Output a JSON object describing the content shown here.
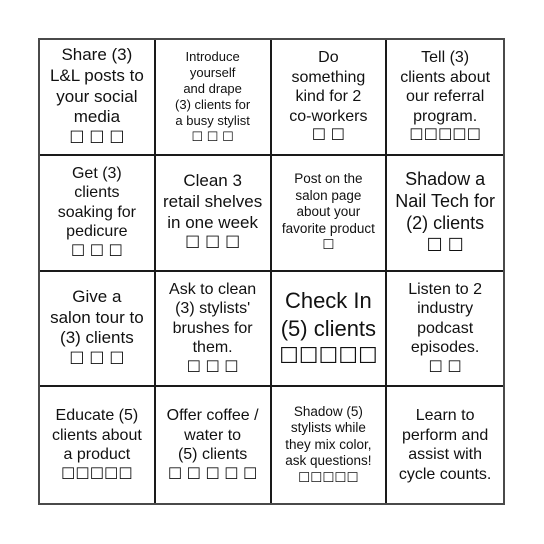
{
  "board": {
    "cells": [
      {
        "text": "Share (3)\nL&L posts to\nyour social\nmedia",
        "boxes": "☐ ☐ ☐"
      },
      {
        "text": "Introduce\nyourself\nand drape\n(3) clients for\na busy stylist",
        "boxes": "☐ ☐ ☐"
      },
      {
        "text": "Do\nsomething\nkind for 2\nco-workers",
        "boxes": "☐ ☐"
      },
      {
        "text": "Tell (3)\nclients about\nour referral\nprogram.",
        "boxes": "☐☐☐☐☐"
      },
      {
        "text": "Get (3)\nclients\nsoaking for\npedicure",
        "boxes": "☐ ☐ ☐"
      },
      {
        "text": "Clean 3\nretail shelves\nin one week",
        "boxes": "☐ ☐ ☐"
      },
      {
        "text": "Post on the\nsalon page\nabout your\nfavorite product",
        "boxes": "☐"
      },
      {
        "text": "Shadow a\nNail Tech for\n(2) clients",
        "boxes": "☐ ☐"
      },
      {
        "text": "Give a\nsalon tour to\n(3) clients",
        "boxes": "☐ ☐ ☐"
      },
      {
        "text": "Ask to clean\n(3) stylists'\nbrushes for\nthem.",
        "boxes": "☐ ☐ ☐"
      },
      {
        "text": "Check In\n(5) clients",
        "boxes": "☐☐☐☐☐"
      },
      {
        "text": "Listen to 2\nindustry\npodcast\nepisodes.",
        "boxes": "☐ ☐"
      },
      {
        "text": "Educate (5)\nclients about\na product",
        "boxes": "☐☐☐☐☐"
      },
      {
        "text": "Offer coffee /\nwater to\n(5) clients",
        "boxes": "☐ ☐ ☐ ☐ ☐"
      },
      {
        "text": "Shadow (5)\nstylists while\nthey mix color,\nask questions!",
        "boxes": "☐☐☐☐☐"
      },
      {
        "text": "Learn to\nperform and\nassist with\ncycle counts.",
        "boxes": ""
      }
    ]
  }
}
